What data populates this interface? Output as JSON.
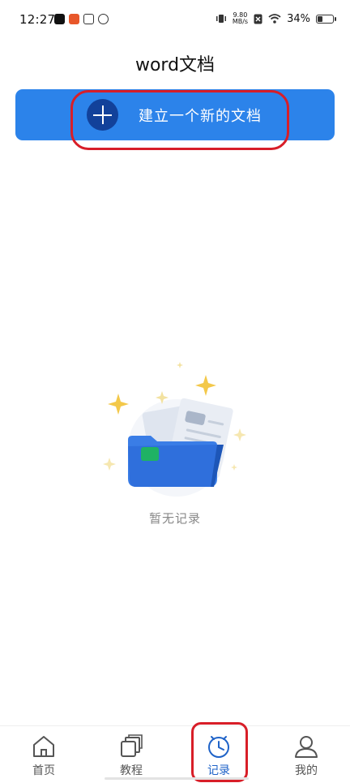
{
  "status_bar": {
    "time": "12:27",
    "net_speed_value": "9.80",
    "net_speed_unit": "MB/s",
    "battery": "34%",
    "battery_level": 0.34
  },
  "header": {
    "title": "word文档"
  },
  "new_doc_button": {
    "label": "建立一个新的文档"
  },
  "empty_state": {
    "message": "暂无记录"
  },
  "bottom_nav": {
    "items": [
      {
        "label": "首页",
        "icon": "home-icon"
      },
      {
        "label": "教程",
        "icon": "tutorial-icon"
      },
      {
        "label": "记录",
        "icon": "record-clock-icon",
        "active": true
      },
      {
        "label": "我的",
        "icon": "profile-icon"
      }
    ]
  },
  "colors": {
    "primary": "#2c83ea",
    "plus_circle": "#12419a",
    "active_tab": "#1f63c8",
    "annotation": "#d81e28"
  }
}
